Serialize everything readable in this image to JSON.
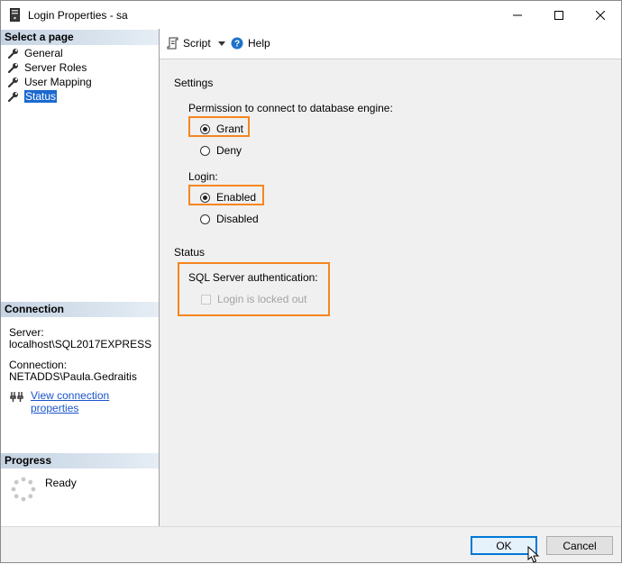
{
  "window": {
    "title": "Login Properties - sa"
  },
  "left_panel": {
    "select_page_header": "Select a page",
    "pages": [
      {
        "label": "General",
        "selected": false
      },
      {
        "label": "Server Roles",
        "selected": false
      },
      {
        "label": "User Mapping",
        "selected": false
      },
      {
        "label": "Status",
        "selected": true
      }
    ],
    "connection": {
      "header": "Connection",
      "server_label": "Server:",
      "server_value": "localhost\\SQL2017EXPRESS",
      "connection_label": "Connection:",
      "connection_value": "NETADDS\\Paula.Gedraitis",
      "link": "View connection properties"
    },
    "progress": {
      "header": "Progress",
      "status": "Ready"
    }
  },
  "toolbar": {
    "script_label": "Script",
    "help_label": "Help"
  },
  "settings": {
    "header": "Settings",
    "permission_label": "Permission to connect to database engine:",
    "grant_label": "Grant",
    "deny_label": "Deny",
    "permission_selected": "Grant",
    "login_label": "Login:",
    "enabled_label": "Enabled",
    "disabled_label": "Disabled",
    "login_selected": "Enabled"
  },
  "status": {
    "header": "Status",
    "auth_label": "SQL Server authentication:",
    "locked_out_label": "Login is locked out",
    "locked_out_checked": false
  },
  "footer": {
    "ok_label": "OK",
    "cancel_label": "Cancel"
  },
  "colors": {
    "highlight": "#f5861f",
    "selection": "#1c69cf",
    "link": "#1a55cc"
  }
}
